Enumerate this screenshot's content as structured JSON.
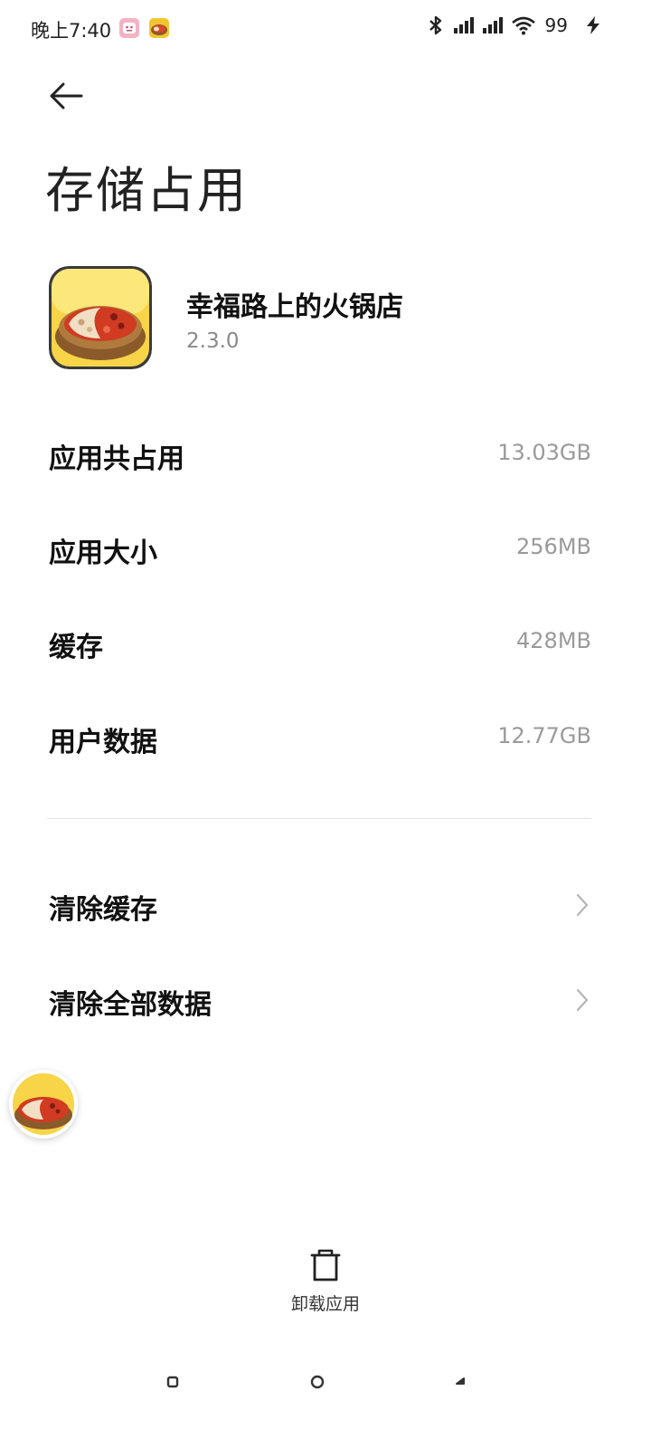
{
  "status_bar": {
    "time": "晚上7:40",
    "battery": "99",
    "icons": [
      "notification-app-icon",
      "game-app-icon",
      "bluetooth-icon",
      "signal-icon",
      "signal-icon",
      "wifi-icon",
      "charging-icon"
    ]
  },
  "header": {
    "back_icon": "back-arrow-icon",
    "title": "存储占用"
  },
  "app": {
    "name": "幸福路上的火锅店",
    "version": "2.3.0"
  },
  "storage_rows": [
    {
      "label": "应用共占用",
      "value": "13.03GB"
    },
    {
      "label": "应用大小",
      "value": "256MB"
    },
    {
      "label": "缓存",
      "value": "428MB"
    },
    {
      "label": "用户数据",
      "value": "12.77GB"
    }
  ],
  "actions": [
    {
      "label": "清除缓存",
      "icon": "chevron-right-icon"
    },
    {
      "label": "清除全部数据",
      "icon": "chevron-right-icon"
    }
  ],
  "bottom": {
    "uninstall_label": "卸载应用",
    "uninstall_icon": "trash-icon"
  },
  "nav": [
    "recents-square-icon",
    "home-circle-icon",
    "back-triangle-icon"
  ],
  "colors": {
    "background": "#ffffff",
    "text_primary": "#111111",
    "text_secondary": "#9a9a9a",
    "divider": "#e3e3e3"
  }
}
